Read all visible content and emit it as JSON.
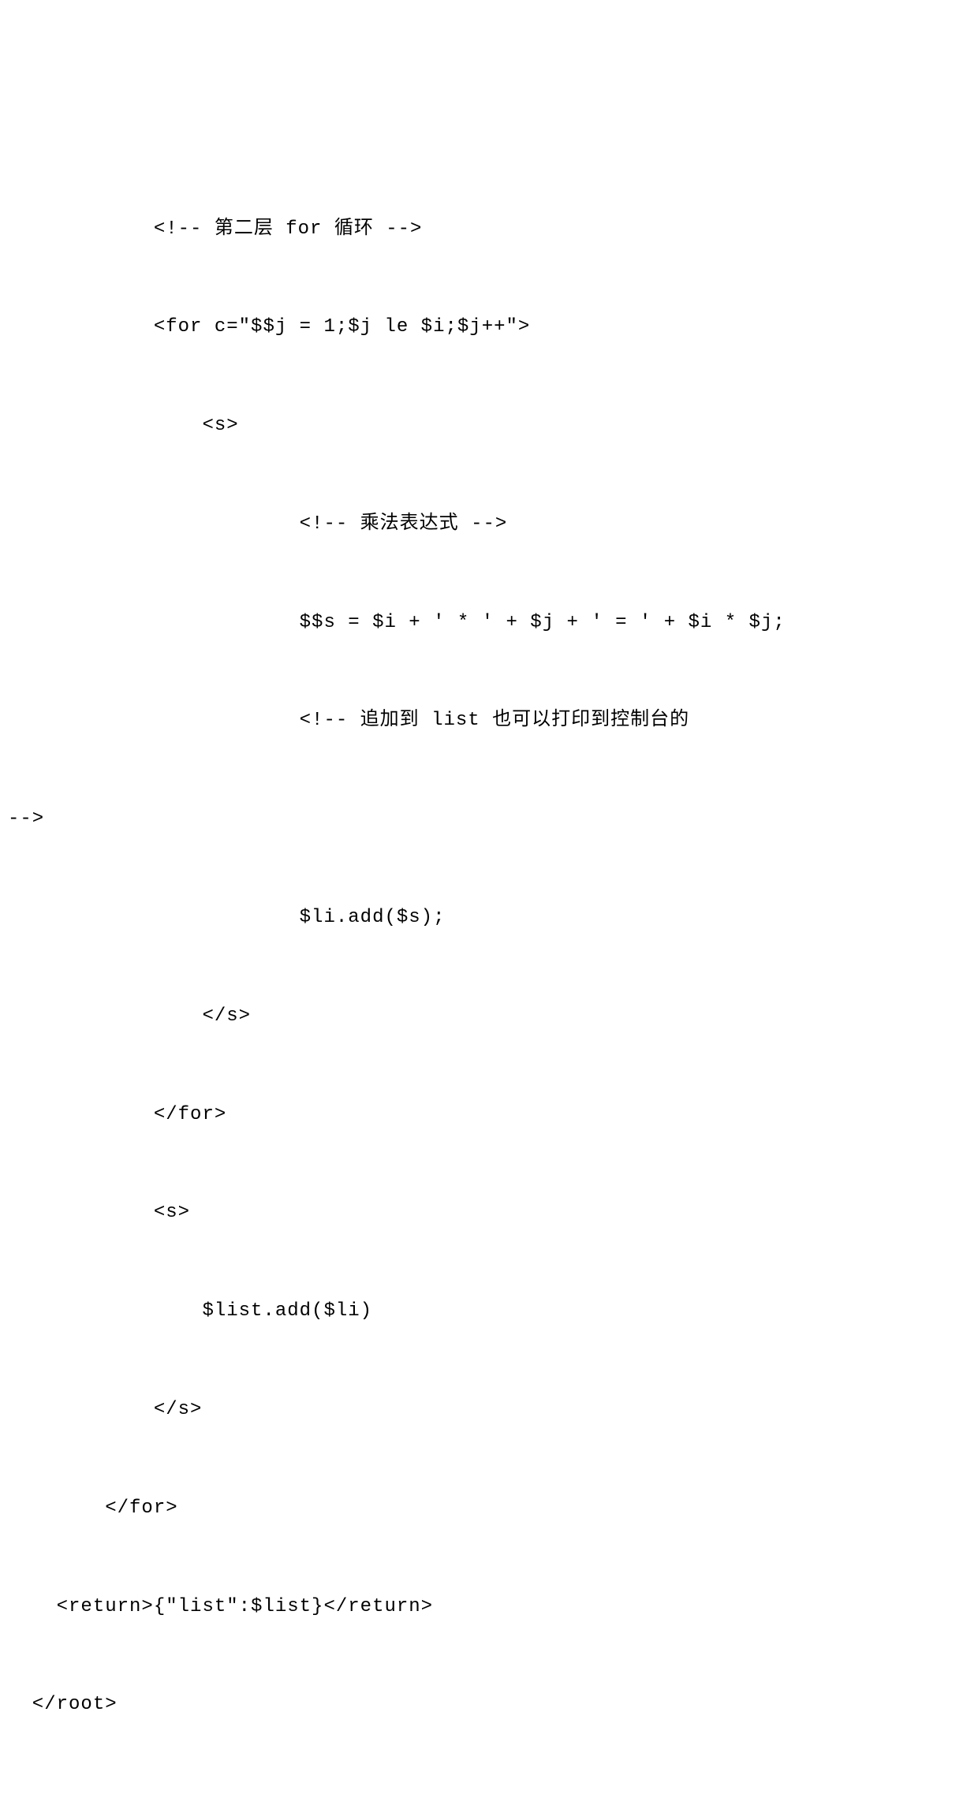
{
  "code": {
    "lines": [
      {
        "indent": 12,
        "text": "<!-- 第二层 for 循环 -->"
      },
      {
        "indent": 12,
        "text": "<for c=\"$$j = 1;$j le $i;$j++\">"
      },
      {
        "indent": 16,
        "text": "<s>"
      },
      {
        "indent": 24,
        "text": "<!-- 乘法表达式 -->"
      },
      {
        "indent": 24,
        "text": "$$s = $i + ' * ' + $j + ' = ' + $i * $j;"
      },
      {
        "indent": 24,
        "text": "<!-- 追加到 list 也可以打印到控制台的"
      },
      {
        "indent": -1,
        "text": "-->"
      },
      {
        "indent": 24,
        "text": "$li.add($s);"
      },
      {
        "indent": 16,
        "text": "</s>"
      },
      {
        "indent": 12,
        "text": "</for>"
      },
      {
        "indent": 12,
        "text": "<s>"
      },
      {
        "indent": 16,
        "text": "$list.add($li)"
      },
      {
        "indent": 12,
        "text": "</s>"
      },
      {
        "indent": 8,
        "text": "</for>"
      },
      {
        "indent": 4,
        "text": "<return>{\"list\":$list}</return>"
      },
      {
        "indent": 2,
        "text": "</root>"
      }
    ]
  }
}
